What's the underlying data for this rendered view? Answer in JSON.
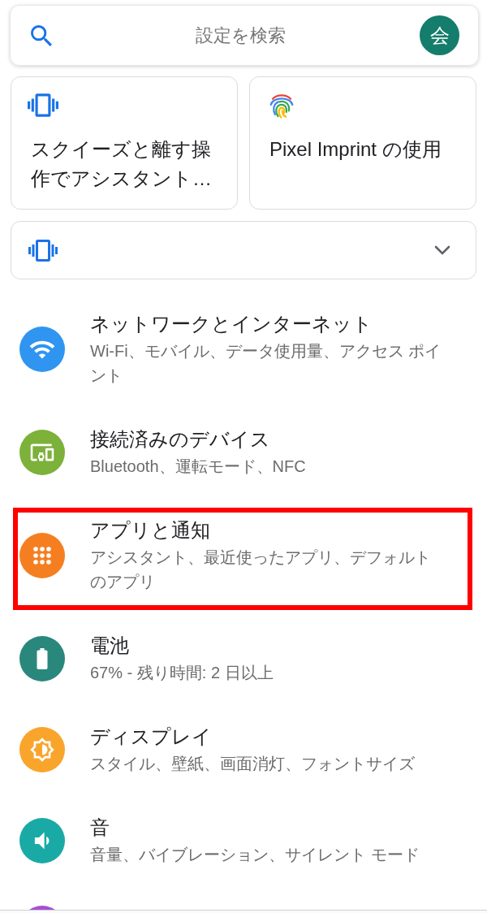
{
  "search": {
    "placeholder": "設定を検索",
    "avatar": "会"
  },
  "suggestions": [
    {
      "title": "スクイーズと離す操作でアシスタント…"
    },
    {
      "title": "Pixel Imprint の使用"
    }
  ],
  "condition_card": {
    "expanded": false
  },
  "settings": [
    {
      "title": "ネットワークとインターネット",
      "summary": "Wi-Fi、モバイル、データ使用量、アクセス ポイント",
      "color": "#2f95f0",
      "highlighted": false
    },
    {
      "title": "接続済みのデバイス",
      "summary": "Bluetooth、運転モード、NFC",
      "color": "#7cb13a",
      "highlighted": false
    },
    {
      "title": "アプリと通知",
      "summary": "アシスタント、最近使ったアプリ、デフォルトのアプリ",
      "color": "#f57f20",
      "highlighted": true
    },
    {
      "title": "電池",
      "summary": "67% - 残り時間: 2 日以上",
      "color": "#2a877c",
      "highlighted": false
    },
    {
      "title": "ディスプレイ",
      "summary": "スタイル、壁紙、画面消灯、フォントサイズ",
      "color": "#f9a52c",
      "highlighted": false
    },
    {
      "title": "音",
      "summary": "音量、バイブレーション、サイレント モード",
      "color": "#1aaaa6",
      "highlighted": false
    }
  ],
  "cut_off_item": {
    "color": "#a64fd6"
  }
}
